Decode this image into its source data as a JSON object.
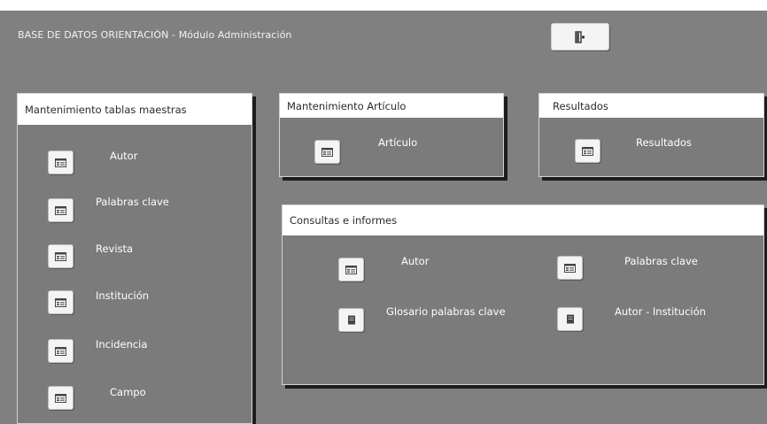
{
  "app": {
    "title": "BASE DE DATOS ORIENTACIÓN - Módulo Administración",
    "exit_icon": "exit-door-icon"
  },
  "colors": {
    "background": "#808080",
    "panel_header": "#ffffff",
    "panel_shadow": "#1c1c1c",
    "button_face": "#f4f4f4"
  },
  "panels": {
    "maestras": {
      "title": "Mantenimiento tablas maestras",
      "items": [
        {
          "label": "Autor",
          "icon": "form-icon"
        },
        {
          "label": "Palabras clave",
          "icon": "form-icon"
        },
        {
          "label": "Revista",
          "icon": "form-icon"
        },
        {
          "label": "Institución",
          "icon": "form-icon"
        },
        {
          "label": "Incidencia",
          "icon": "form-icon"
        },
        {
          "label": "Campo",
          "icon": "form-icon"
        }
      ]
    },
    "articulo": {
      "title": "Mantenimiento Artículo",
      "items": [
        {
          "label": "Artículo",
          "icon": "form-icon"
        }
      ]
    },
    "resultados": {
      "title": "Resultados",
      "items": [
        {
          "label": "Resultados",
          "icon": "form-icon"
        }
      ]
    },
    "consultas": {
      "title": "Consultas e informes",
      "items": [
        {
          "label": "Autor",
          "icon": "form-icon"
        },
        {
          "label": "Palabras clave",
          "icon": "form-icon"
        },
        {
          "label": "Glosario palabras clave",
          "icon": "report-icon"
        },
        {
          "label": "Autor - Institución",
          "icon": "report-icon"
        }
      ]
    }
  }
}
